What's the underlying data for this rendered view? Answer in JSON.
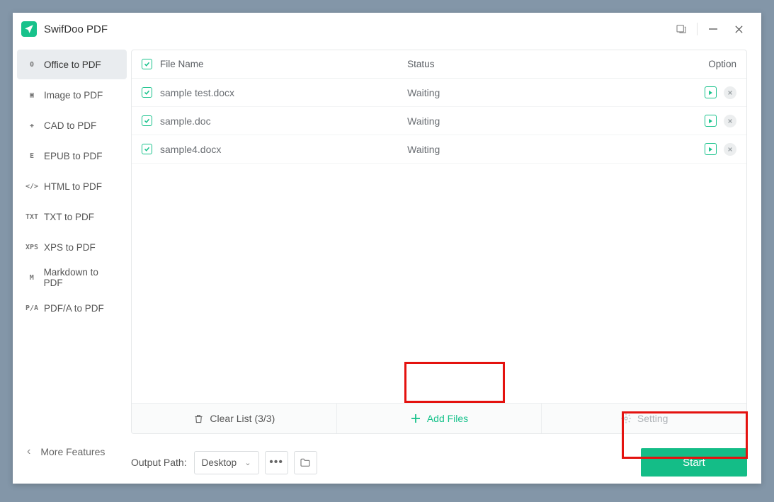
{
  "app": {
    "title": "SwifDoo PDF"
  },
  "sidebar": {
    "items": [
      {
        "icon": "0",
        "label": "Office to PDF",
        "active": true
      },
      {
        "icon": "▣",
        "label": "Image to PDF"
      },
      {
        "icon": "✚",
        "label": "CAD to PDF"
      },
      {
        "icon": "E",
        "label": "EPUB to PDF"
      },
      {
        "icon": "</>",
        "label": "HTML to PDF"
      },
      {
        "icon": "TXT",
        "label": "TXT to PDF"
      },
      {
        "icon": "XPS",
        "label": "XPS to PDF"
      },
      {
        "icon": "M",
        "label": "Markdown to PDF"
      },
      {
        "icon": "P/A",
        "label": "PDF/A to PDF"
      }
    ],
    "more_label": "More Features"
  },
  "table": {
    "headers": {
      "filename": "File Name",
      "status": "Status",
      "option": "Option"
    },
    "rows": [
      {
        "name": "sample test.docx",
        "status": "Waiting"
      },
      {
        "name": "sample.doc",
        "status": "Waiting"
      },
      {
        "name": "sample4.docx",
        "status": "Waiting"
      }
    ]
  },
  "toolbar": {
    "clear_label": "Clear List (3/3)",
    "add_label": "Add Files",
    "setting_label": "Setting"
  },
  "footer": {
    "output_label": "Output Path:",
    "output_value": "Desktop",
    "start_label": "Start"
  },
  "colors": {
    "accent": "#14bd87"
  }
}
